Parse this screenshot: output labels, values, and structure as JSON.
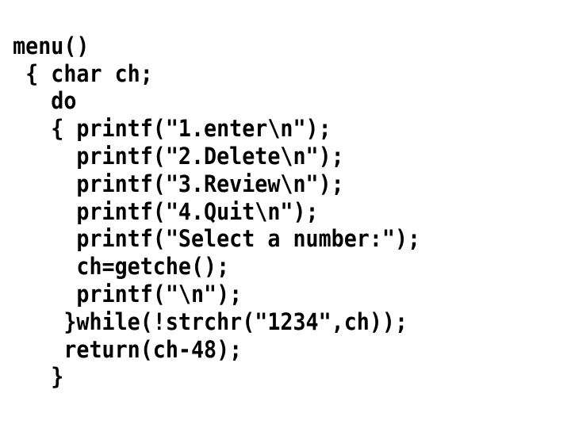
{
  "code": {
    "l1": " menu()",
    "l2": "  { char ch;",
    "l3": "    do",
    "l4": "    { printf(\"1.enter\\n\");",
    "l5": "      printf(\"2.Delete\\n\");",
    "l6": "      printf(\"3.Review\\n\");",
    "l7": "      printf(\"4.Quit\\n\");",
    "l8": "      printf(\"Select a number:\");",
    "l9": "      ch=getche();",
    "l10": "      printf(\"\\n\");",
    "l11": "     }while(!strchr(\"1234\",ch));",
    "l12": "     return(ch-48);",
    "l13": "    }"
  }
}
